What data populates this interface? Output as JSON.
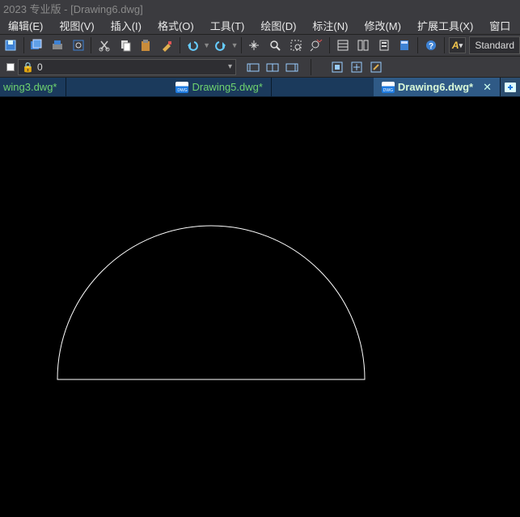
{
  "title": "2023 专业版 - [Drawing6.dwg]",
  "menus": {
    "edit": "编辑(E)",
    "view": "视图(V)",
    "insert": "插入(I)",
    "format": "格式(O)",
    "tools": "工具(T)",
    "draw": "绘图(D)",
    "dimension": "标注(N)",
    "modify": "修改(M)",
    "extension": "扩展工具(X)",
    "window": "窗口"
  },
  "layer": {
    "name": "0"
  },
  "style": {
    "name": "Standard"
  },
  "tabs": {
    "t1": "wing3.dwg*",
    "t2": "Drawing5.dwg*",
    "t3": "Drawing6.dwg*"
  },
  "chart_data": {
    "type": "arc",
    "title": "Drawing6.dwg",
    "description": "Semi-circle arc closed by chord",
    "center": [
      261,
      349
    ],
    "radius": 190,
    "start_angle_deg": 0,
    "end_angle_deg": 180,
    "closed": true
  }
}
